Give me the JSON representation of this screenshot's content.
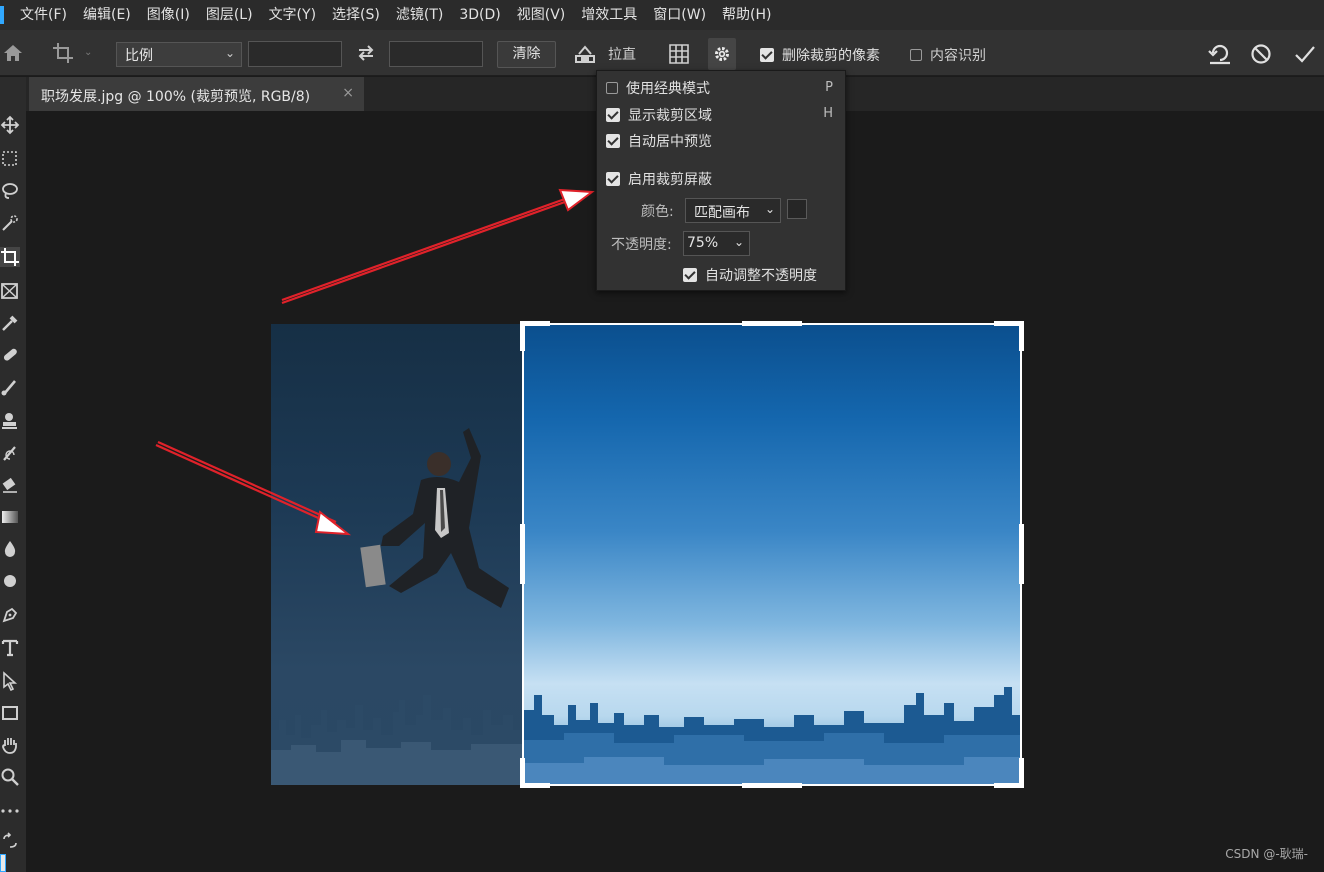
{
  "menu": {
    "items": [
      "文件(F)",
      "编辑(E)",
      "图像(I)",
      "图层(L)",
      "文字(Y)",
      "选择(S)",
      "滤镜(T)",
      "3D(D)",
      "视图(V)",
      "增效工具",
      "窗口(W)",
      "帮助(H)"
    ]
  },
  "options": {
    "ratio_select": "比例",
    "width_value": "",
    "height_value": "",
    "clear_label": "清除",
    "straighten_label": "拉直",
    "delete_pixels_label": "删除裁剪的像素",
    "delete_pixels_checked": true,
    "content_aware_label": "内容识别",
    "content_aware_checked": false
  },
  "document": {
    "tab_title": "职场发展.jpg @ 100% (裁剪预览, RGB/8)",
    "close_glyph": "×"
  },
  "settings_popup": {
    "classic_mode": {
      "label": "使用经典模式",
      "shortcut": "P",
      "checked": false
    },
    "show_cropped_area": {
      "label": "显示裁剪区域",
      "shortcut": "H",
      "checked": true
    },
    "auto_center_preview": {
      "label": "自动居中预览",
      "checked": true
    },
    "enable_crop_shield": {
      "label": "启用裁剪屏蔽",
      "checked": true
    },
    "color_label": "颜色:",
    "color_value": "匹配画布",
    "opacity_label": "不透明度:",
    "opacity_value": "75%",
    "auto_adjust_opacity": {
      "label": "自动调整不透明度",
      "checked": true
    }
  },
  "colors": {
    "accent": "#31a8ff",
    "arrow": "#e0222a",
    "crop_frame": "#ffffff"
  },
  "watermark": "CSDN @-耿瑞-"
}
